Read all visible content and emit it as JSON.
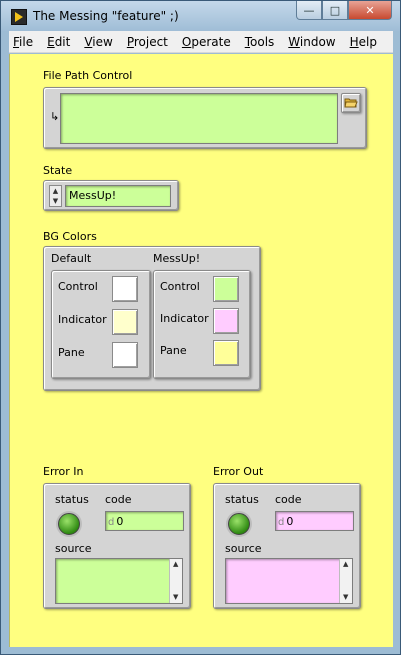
{
  "window": {
    "title": "The Messing \"feature\" ;)",
    "minimize_glyph": "—",
    "maximize_glyph": "□",
    "close_glyph": "✕"
  },
  "menu": {
    "items": [
      {
        "label": "File",
        "ul": "F",
        "rest": "ile"
      },
      {
        "label": "Edit",
        "ul": "E",
        "rest": "dit"
      },
      {
        "label": "View",
        "ul": "V",
        "rest": "iew"
      },
      {
        "label": "Project",
        "ul": "P",
        "rest": "roject"
      },
      {
        "label": "Operate",
        "ul": "O",
        "rest": "perate"
      },
      {
        "label": "Tools",
        "ul": "T",
        "rest": "ools"
      },
      {
        "label": "Window",
        "ul": "W",
        "rest": "indow"
      },
      {
        "label": "Help",
        "ul": "H",
        "rest": "elp"
      }
    ]
  },
  "file_path": {
    "label": "File Path Control",
    "value": "",
    "path_glyph": "↳",
    "browse_icon": "folder-open-icon"
  },
  "state": {
    "label": "State",
    "value": "MessUp!"
  },
  "bg_colors": {
    "label": "BG Colors",
    "default": {
      "label": "Default",
      "control": "Control",
      "indicator": "Indicator",
      "pane": "Pane"
    },
    "messup": {
      "label": "MessUp!",
      "control": "Control",
      "indicator": "Indicator",
      "pane": "Pane"
    }
  },
  "error_in": {
    "label": "Error In",
    "status_label": "status",
    "code_label": "code",
    "code_radix": "d",
    "code_value": "0",
    "source_label": "source",
    "source_value": ""
  },
  "error_out": {
    "label": "Error Out",
    "status_label": "status",
    "code_label": "code",
    "code_radix": "d",
    "code_value": "0",
    "source_label": "source",
    "source_value": ""
  },
  "colors": {
    "panel": "#ffff80",
    "control_green": "#ccff99",
    "indicator_pink": "#ffccff",
    "status_led_green": "#2f8a12"
  }
}
